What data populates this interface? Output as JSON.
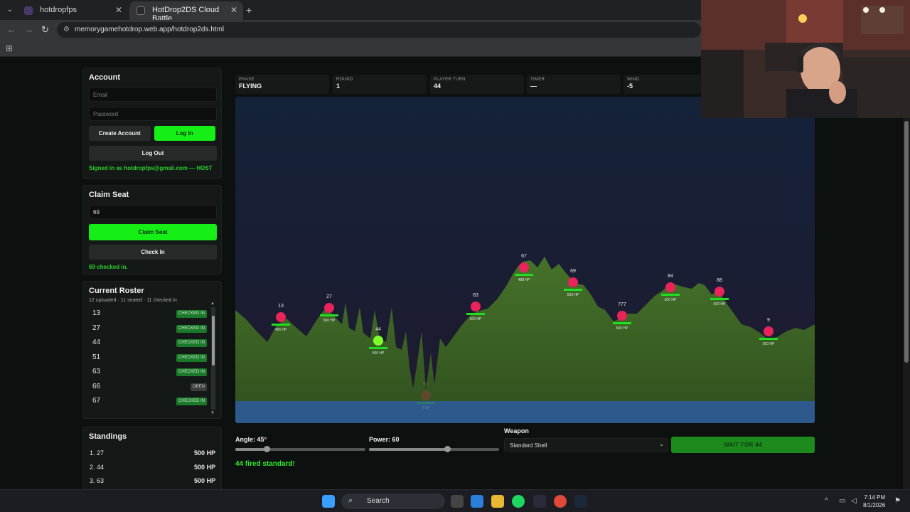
{
  "browser": {
    "tabs": [
      {
        "title": "hotdropfps",
        "active": false
      },
      {
        "title": "HotDrop2DS Cloud Battle",
        "active": true
      }
    ],
    "url": "memorygamehotdrop.web.app/hotdrop2ds.html"
  },
  "account": {
    "heading": "Account",
    "email_placeholder": "Email",
    "password_placeholder": "Password",
    "create_label": "Create Account",
    "login_label": "Log In",
    "logout_label": "Log Out",
    "status": "Signed in as hotdropfps@gmail.com — HOST"
  },
  "claim": {
    "heading": "Claim Seat",
    "seat_value": "69",
    "claim_label": "Claim Seat",
    "checkin_label": "Check In",
    "status": "69 checked in."
  },
  "roster": {
    "heading": "Current Roster",
    "meta": "12 uploaded · 11 seated · 11 checked in",
    "rows": [
      {
        "id": "13",
        "status": "CHECKED IN"
      },
      {
        "id": "27",
        "status": "CHECKED IN"
      },
      {
        "id": "44",
        "status": "CHECKED IN"
      },
      {
        "id": "51",
        "status": "CHECKED IN"
      },
      {
        "id": "63",
        "status": "CHECKED IN"
      },
      {
        "id": "66",
        "status": "OPEN"
      },
      {
        "id": "67",
        "status": "CHECKED IN"
      }
    ]
  },
  "standings": {
    "heading": "Standings",
    "rows": [
      {
        "rank": "1. 27",
        "hp": "500 HP"
      },
      {
        "rank": "2. 44",
        "hp": "500 HP"
      },
      {
        "rank": "3. 63",
        "hp": "500 HP"
      }
    ]
  },
  "stats": [
    {
      "key": "PHASE",
      "value": "FLYING"
    },
    {
      "key": "ROUND",
      "value": "1"
    },
    {
      "key": "PLAYER TURN",
      "value": "44"
    },
    {
      "key": "TIMER",
      "value": "—"
    },
    {
      "key": "WIND",
      "value": "-5"
    }
  ],
  "game": {
    "players": [
      {
        "id": "13",
        "hp": "495 HP",
        "active": false
      },
      {
        "id": "27",
        "hp": "500 HP",
        "active": false
      },
      {
        "id": "44",
        "hp": "500 HP",
        "active": true
      },
      {
        "id": "63",
        "hp": "500 HP",
        "active": false
      },
      {
        "id": "67",
        "hp": "488 HP",
        "active": false
      },
      {
        "id": "69",
        "hp": "500 HP",
        "active": false
      },
      {
        "id": "777",
        "hp": "500 HP",
        "active": false
      },
      {
        "id": "84",
        "hp": "500 HP",
        "active": false
      },
      {
        "id": "88",
        "hp": "500 HP",
        "active": false
      },
      {
        "id": "9",
        "hp": "500 HP",
        "active": false
      },
      {
        "id": "51",
        "hp": "0 HP",
        "active": false
      }
    ],
    "colors": {
      "sky": "#1a2238",
      "ground": "#3f6626",
      "water": "#2e5a94",
      "tank": "#e8245a",
      "active": "#7dff2a",
      "hpbar": "#22dd22"
    }
  },
  "controls": {
    "angle_label": "Angle: 45°",
    "angle_fraction": 0.24,
    "power_label": "Power: 60",
    "power_fraction": 0.6,
    "weapon_heading": "Weapon",
    "weapon_value": "Standard Shell",
    "action_label": "WAIT FOR 44",
    "message": "44 fired standard!"
  },
  "taskbar": {
    "search_label": "Search",
    "time": "7:14 PM",
    "date": "8/1/2026"
  }
}
